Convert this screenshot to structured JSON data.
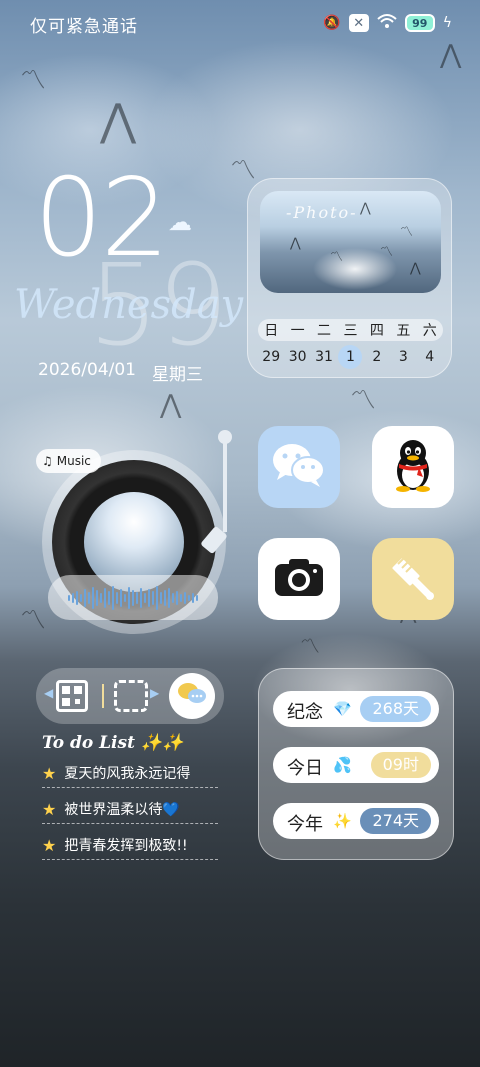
{
  "status_bar": {
    "left_text": "仅可紧急通话",
    "battery": "99",
    "icons": [
      "mute-icon",
      "close-box-icon",
      "wifi-icon",
      "battery-icon",
      "charging-icon"
    ]
  },
  "clock": {
    "hour": "02",
    "minute": "59",
    "weekday_en": "Wednesday",
    "date": "2026/04/01",
    "weekday_cn": "星期三",
    "weather_icon": "cloud-rain-icon"
  },
  "calendar": {
    "photo_text": "-Photo-",
    "headers": [
      "日",
      "一",
      "二",
      "三",
      "四",
      "五",
      "六"
    ],
    "days": [
      "29",
      "30",
      "31",
      "1",
      "2",
      "3",
      "4"
    ],
    "today": "1"
  },
  "music": {
    "tag_label": "Music",
    "tag_icon": "music-note-icon"
  },
  "apps": [
    {
      "name": "wechat",
      "icon": "wechat-icon"
    },
    {
      "name": "qq",
      "icon": "qq-penguin-icon"
    },
    {
      "name": "camera",
      "icon": "camera-icon"
    },
    {
      "name": "theme",
      "icon": "brush-icon"
    }
  ],
  "todo": {
    "title": "To do List",
    "title_sparkles": "✨✨",
    "items": [
      {
        "text": "夏天的风我永远记得"
      },
      {
        "text": "被世界温柔以待💙"
      },
      {
        "text": "把青春发挥到极致!!"
      }
    ]
  },
  "days_counter": {
    "rows": [
      {
        "label": "纪念",
        "emoji": "💎",
        "value": "268天",
        "bg": "#a7cef3",
        "fg": "#ffffff"
      },
      {
        "label": "今日",
        "emoji": "💦",
        "value": "09时",
        "bg": "#f1dd9c",
        "fg": "#ffffff"
      },
      {
        "label": "今年",
        "emoji": "✨",
        "value": "274天",
        "bg": "#6a8fb8",
        "fg": "#ffffff"
      }
    ]
  }
}
